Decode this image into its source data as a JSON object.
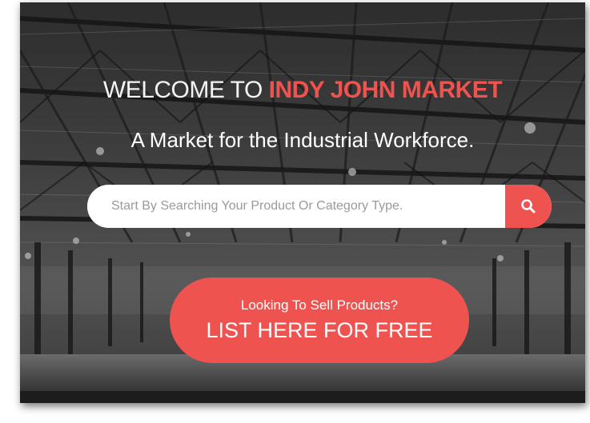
{
  "hero": {
    "welcome_prefix": "WELCOME TO ",
    "brand_name": "INDY JOHN MARKET",
    "tagline": "A Market for the Industrial Workforce."
  },
  "search": {
    "placeholder": "Start By Searching Your Product Or Category Type.",
    "button_icon": "search-icon"
  },
  "cta": {
    "subtitle": "Looking To Sell Products?",
    "label": "LIST HERE FOR FREE"
  },
  "colors": {
    "accent": "#ef5350",
    "text_light": "#ffffff",
    "placeholder": "#9a9a9a"
  }
}
